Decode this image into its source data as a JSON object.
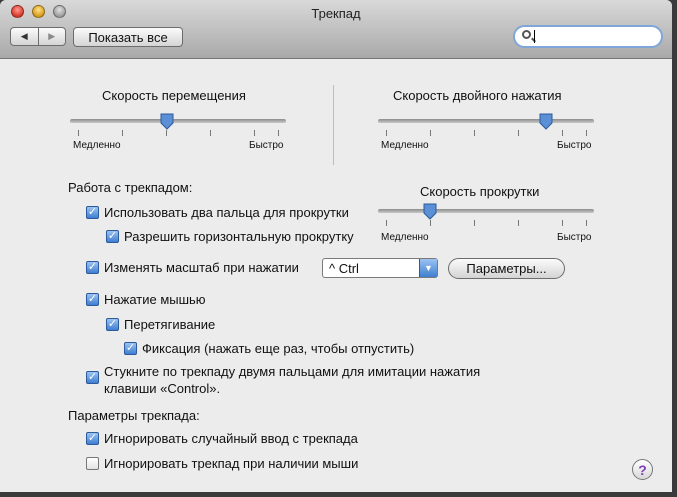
{
  "window": {
    "title": "Трекпад",
    "nav_back": "◀",
    "nav_forward": "▶",
    "show_all": "Показать все",
    "search_value": ""
  },
  "tracking_speed": {
    "label": "Скорость перемещения",
    "min_label": "Медленно",
    "max_label": "Быстро",
    "value": 0.45
  },
  "double_click_speed": {
    "label": "Скорость двойного нажатия",
    "min_label": "Медленно",
    "max_label": "Быстро",
    "value": 0.78
  },
  "scroll_speed": {
    "label": "Скорость прокрутки",
    "min_label": "Медленно",
    "max_label": "Быстро",
    "value": 0.24
  },
  "trackpad_section": {
    "heading": "Работа с трекпадом:",
    "two_finger_scroll": {
      "label": "Использовать два пальца для прокрутки",
      "checked": true
    },
    "horizontal_scroll": {
      "label": "Разрешить горизонтальную прокрутку",
      "checked": true
    },
    "zoom_on_click": {
      "label": "Изменять масштаб при нажатии",
      "checked": true
    },
    "zoom_modifier": "^ Ctrl",
    "options_button": "Параметры...",
    "clicking": {
      "label": "Нажатие мышью",
      "checked": true
    },
    "dragging": {
      "label": "Перетягивание",
      "checked": true
    },
    "drag_lock": {
      "label": "Фиксация (нажать еще раз, чтобы отпустить)",
      "checked": true
    },
    "secondary_click": {
      "label_line1": "Стукните по трекпаду двумя пальцами для имитации нажатия",
      "label_line2": "клавиши «Control».",
      "checked": true
    }
  },
  "options_section": {
    "heading": "Параметры трекпада:",
    "ignore_accidental": {
      "label": "Игнорировать случайный ввод с трекпада",
      "checked": true
    },
    "ignore_with_mouse": {
      "label": "Игнорировать трекпад при наличии мыши",
      "checked": false
    }
  },
  "help_button": "?",
  "colors": {
    "accent": "#3f7fd0",
    "window_bg": "#ececec"
  }
}
